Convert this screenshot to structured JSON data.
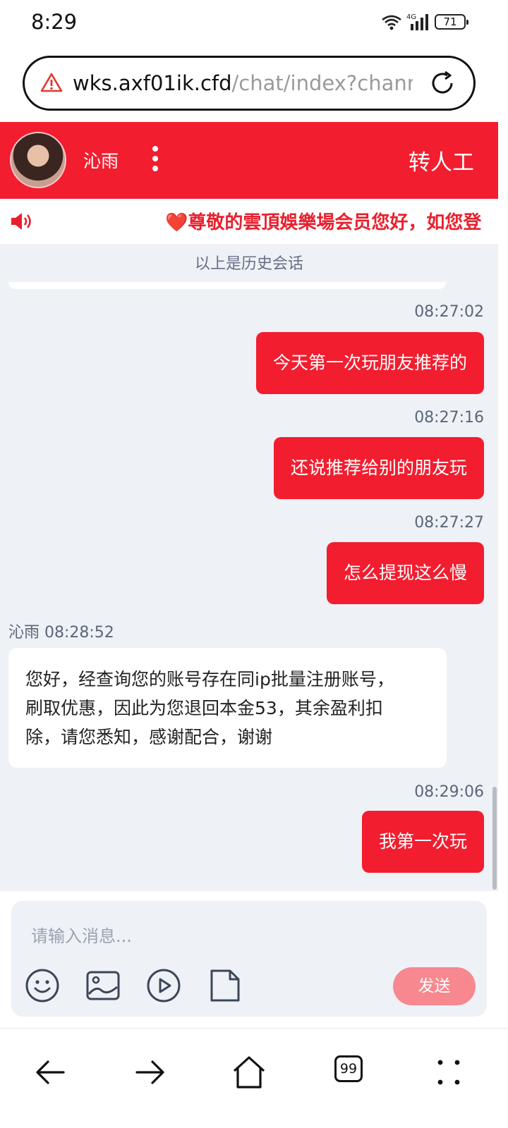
{
  "status_bar": {
    "time": "8:29",
    "network": "4G",
    "battery": "71"
  },
  "url_bar": {
    "host": "wks.axf01ik.cfd",
    "path": "/chat/index?chann"
  },
  "chat_header": {
    "agent_name": "沁雨",
    "transfer_label": "转人工",
    "background_color": "#f21d2f"
  },
  "notice": {
    "text": "❤️尊敬的雲頂娛樂場会员您好，如您登"
  },
  "chat": {
    "history_label": "以上是历史会话",
    "messages": [
      {
        "direction": "outgoing",
        "time": "08:27:02",
        "text": "今天第一次玩朋友推荐的"
      },
      {
        "direction": "outgoing",
        "time": "08:27:16",
        "text": "还说推荐给别的朋友玩"
      },
      {
        "direction": "outgoing",
        "time": "08:27:27",
        "text": "怎么提现这么慢"
      },
      {
        "direction": "incoming",
        "sender_time": "沁雨 08:28:52",
        "lines": [
          "您好，经查询您的账号存在同ip批量注册账号，",
          "刷取优惠，因此为您退回本金53，其余盈利扣",
          "除，请您悉知，感谢配合，谢谢"
        ]
      },
      {
        "direction": "outgoing",
        "time": "08:29:06",
        "text": "我第一次玩"
      }
    ]
  },
  "composer": {
    "placeholder": "请输入消息...",
    "send_label": "发送",
    "tools": [
      "emoji-icon",
      "image-icon",
      "video-icon",
      "file-icon"
    ]
  },
  "bottom_nav": {
    "tab_count": "99",
    "items": [
      "back-arrow-icon",
      "forward-arrow-icon",
      "home-icon",
      "tabs-icon",
      "menu-icon"
    ]
  }
}
